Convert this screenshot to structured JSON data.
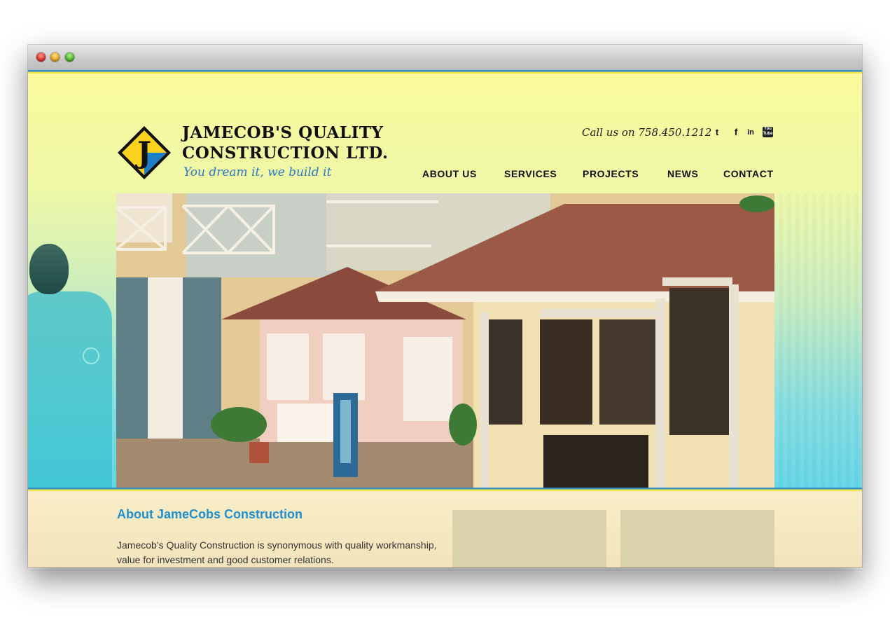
{
  "window": {
    "title_bar_controls": [
      "close",
      "minimize",
      "zoom"
    ]
  },
  "brand": {
    "name_line1": "JAMECOB'S QUALITY",
    "name_line2": "CONSTRUCTION  LTD.",
    "tagline": "You dream it, we build it",
    "logo_letter": "J",
    "colors": {
      "yellow": "#f8d21c",
      "blue": "#1f7ec8"
    }
  },
  "header": {
    "call_us": "Call us on 758.450.1212",
    "social_icons": [
      "twitter-icon",
      "facebook-icon",
      "linkedin-icon",
      "youtube-icon"
    ],
    "social_glyphs": {
      "twitter": "t",
      "facebook": "f",
      "linkedin": "in",
      "youtube": "You Tube"
    }
  },
  "nav": {
    "items": [
      "ABOUT US",
      "SERVICES",
      "PROJECTS",
      "NEWS",
      "CONTACT"
    ]
  },
  "about": {
    "title": "About JameCobs Construction",
    "body": "Jamecob’s Quality Construction is synonymous with quality workmanship, value for investment and good customer relations."
  },
  "theme": {
    "accent_blue": "#1f8fcf",
    "strip_blue": "#2f8ec9",
    "strip_yellow": "#f4e84b"
  }
}
